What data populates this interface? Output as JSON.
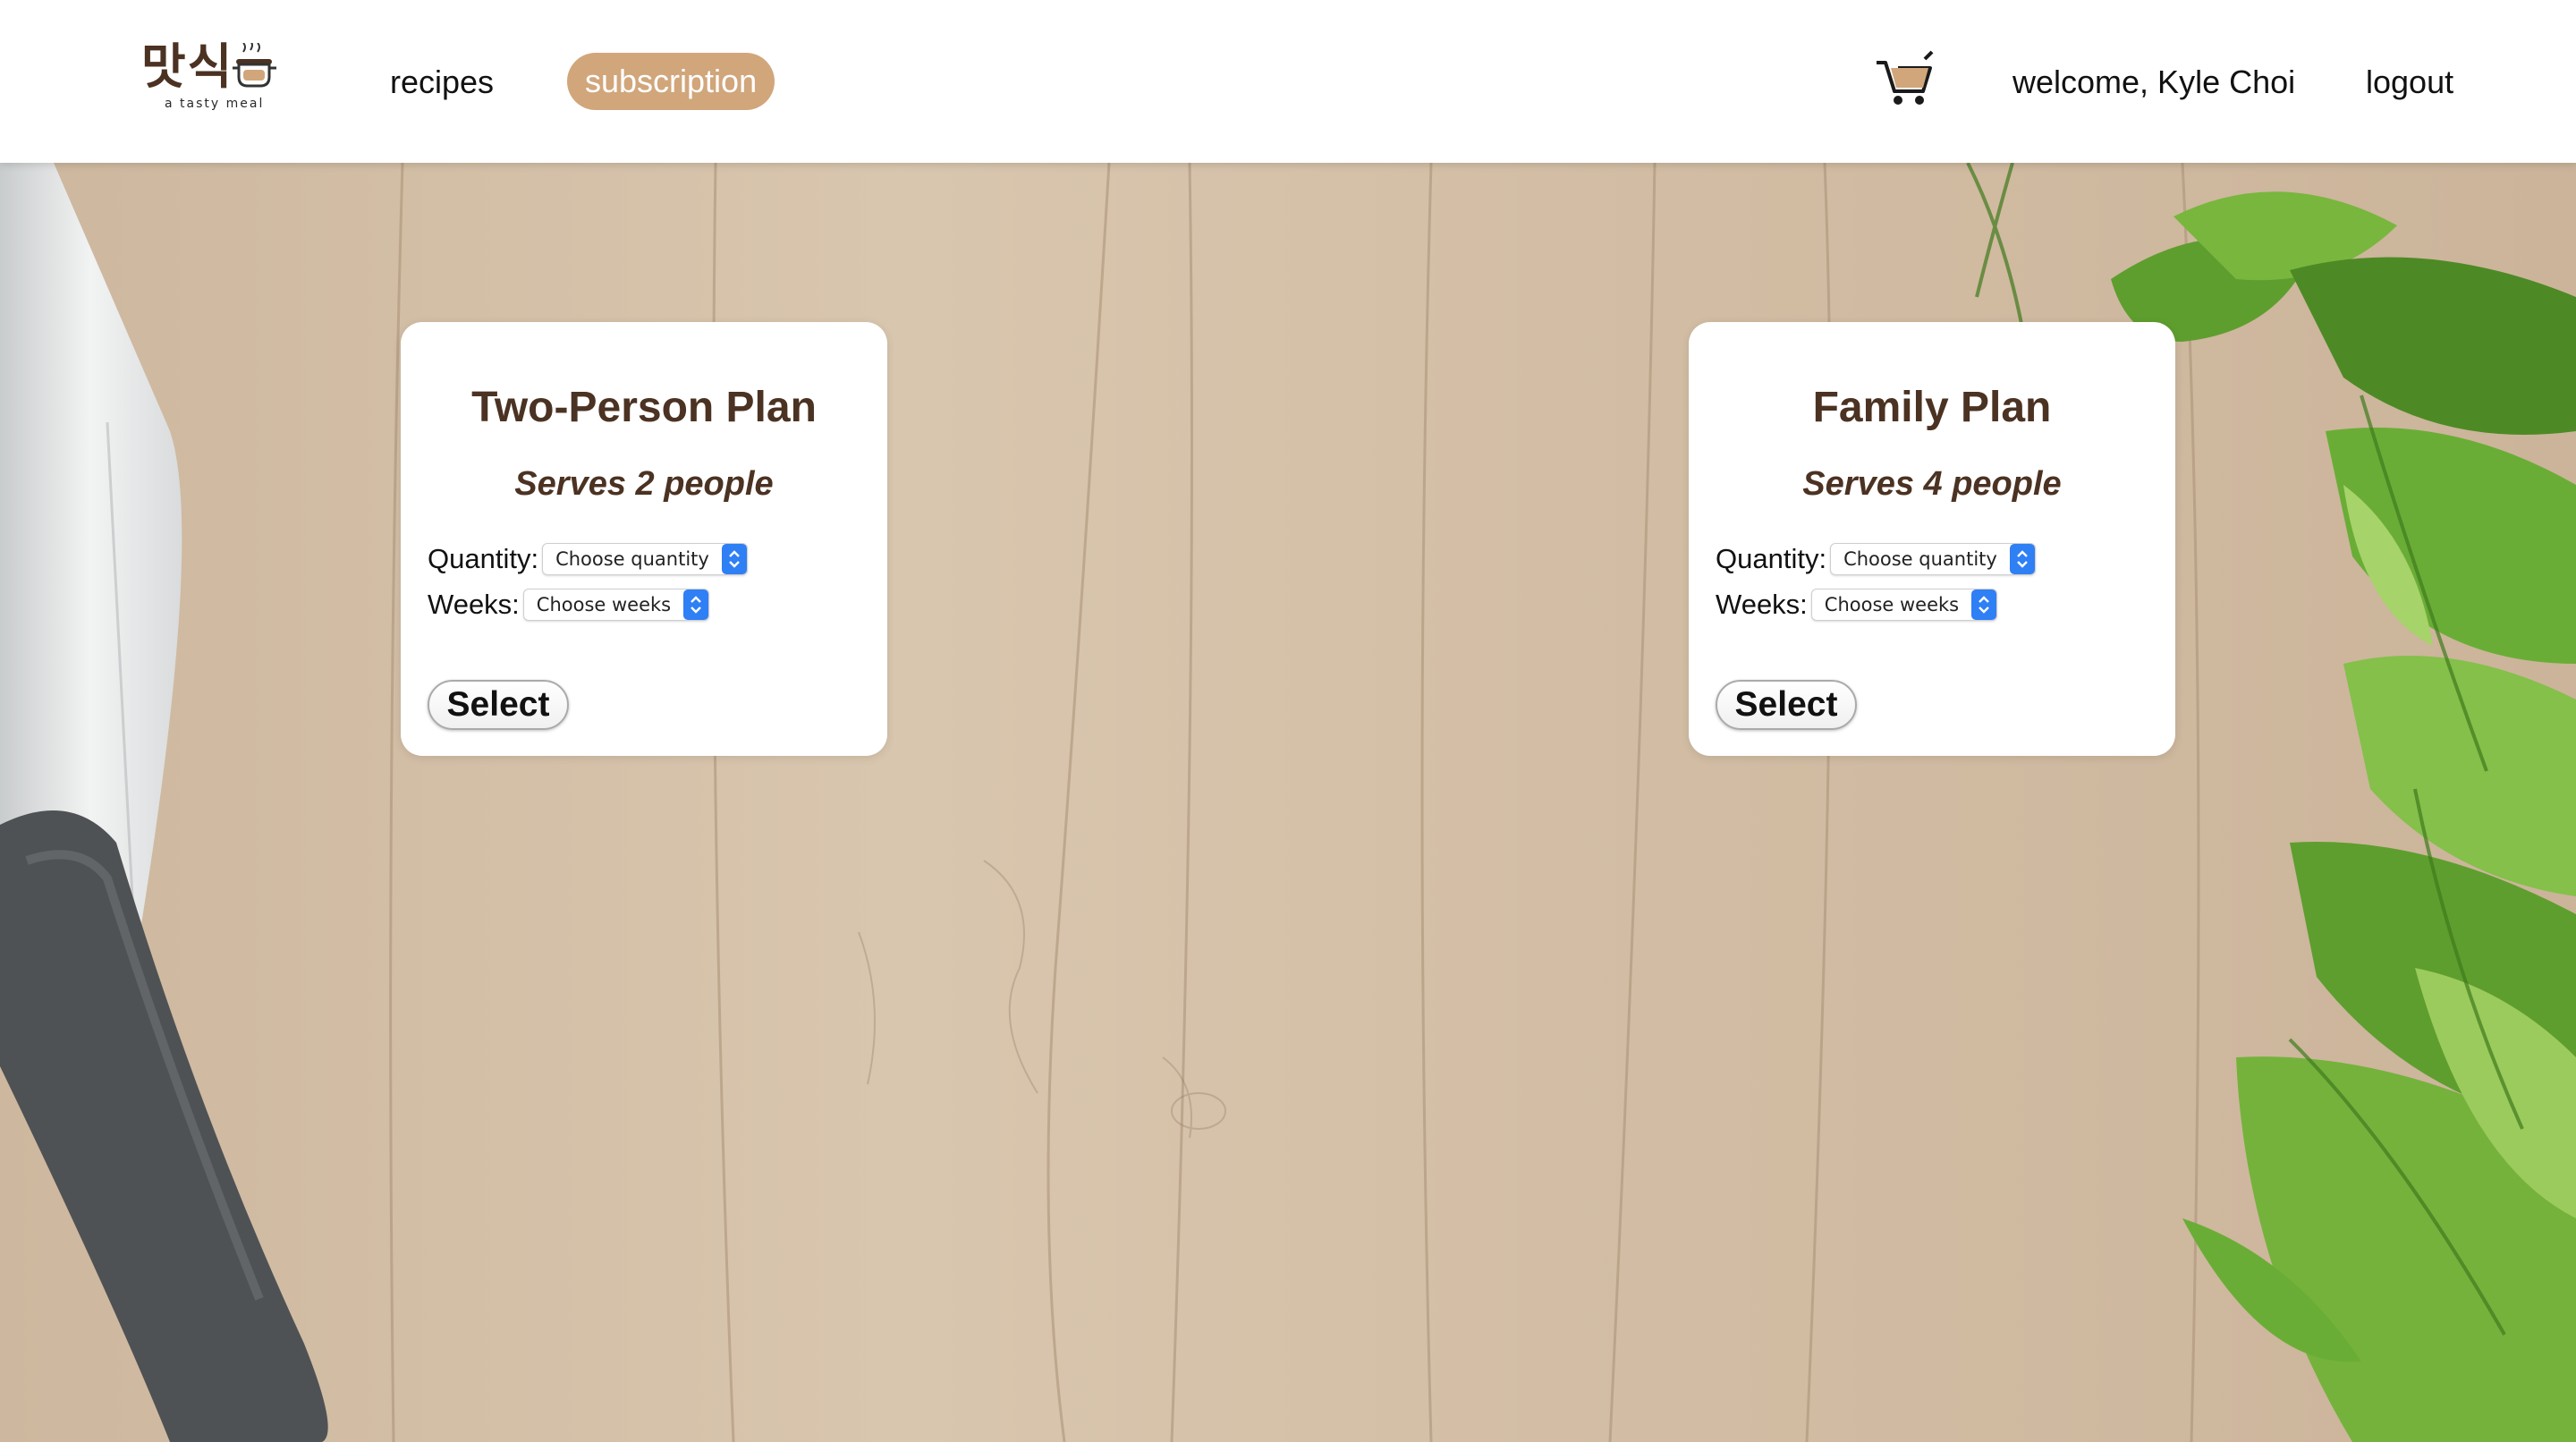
{
  "brand": {
    "hangul": "맛식",
    "tagline": "a tasty meal"
  },
  "nav": {
    "recipes": "recipes",
    "subscription": "subscription",
    "welcome": "welcome, Kyle Choi",
    "logout": "logout"
  },
  "colors": {
    "brand_brown": "#4b3222",
    "active_pill": "#d1a67b",
    "select_accent": "#2f7ff5"
  },
  "plans": [
    {
      "title": "Two-Person Plan",
      "serves": "Serves 2 people",
      "quantity_label": "Quantity:",
      "quantity_value": "Choose quantity",
      "weeks_label": "Weeks:",
      "weeks_value": "Choose weeks",
      "button": "Select"
    },
    {
      "title": "Family Plan",
      "serves": "Serves 4 people",
      "quantity_label": "Quantity:",
      "quantity_value": "Choose quantity",
      "weeks_label": "Weeks:",
      "weeks_value": "Choose weeks",
      "button": "Select"
    }
  ],
  "icons": {
    "cart": "shopping-cart-icon",
    "logo": "cooking-pot-icon",
    "select_arrows": "up-down-chevron-icon"
  }
}
